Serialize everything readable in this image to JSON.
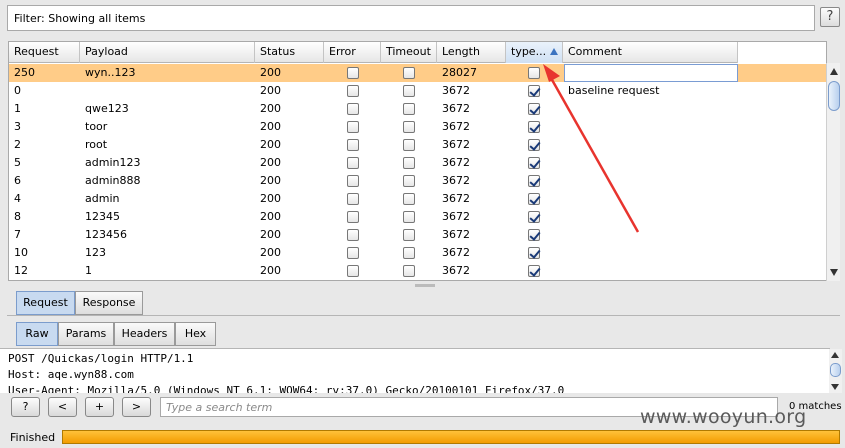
{
  "filter": {
    "text": "Filter: Showing all items",
    "help_label": "?"
  },
  "table": {
    "columns": [
      "Request",
      "Payload",
      "Status",
      "Error",
      "Timeout",
      "Length",
      "type...",
      "Comment"
    ],
    "sorted_column": "type...",
    "rows": [
      {
        "request": "250",
        "payload": "wyn..123",
        "status": "200",
        "error": false,
        "timeout": false,
        "length": "28027",
        "type": false,
        "comment": "",
        "selected": true
      },
      {
        "request": "0",
        "payload": "",
        "status": "200",
        "error": false,
        "timeout": false,
        "length": "3672",
        "type": true,
        "comment": "baseline request",
        "selected": false
      },
      {
        "request": "1",
        "payload": "qwe123",
        "status": "200",
        "error": false,
        "timeout": false,
        "length": "3672",
        "type": true,
        "comment": "",
        "selected": false
      },
      {
        "request": "3",
        "payload": "toor",
        "status": "200",
        "error": false,
        "timeout": false,
        "length": "3672",
        "type": true,
        "comment": "",
        "selected": false
      },
      {
        "request": "2",
        "payload": "root",
        "status": "200",
        "error": false,
        "timeout": false,
        "length": "3672",
        "type": true,
        "comment": "",
        "selected": false
      },
      {
        "request": "5",
        "payload": "admin123",
        "status": "200",
        "error": false,
        "timeout": false,
        "length": "3672",
        "type": true,
        "comment": "",
        "selected": false
      },
      {
        "request": "6",
        "payload": "admin888",
        "status": "200",
        "error": false,
        "timeout": false,
        "length": "3672",
        "type": true,
        "comment": "",
        "selected": false
      },
      {
        "request": "4",
        "payload": "admin",
        "status": "200",
        "error": false,
        "timeout": false,
        "length": "3672",
        "type": true,
        "comment": "",
        "selected": false
      },
      {
        "request": "8",
        "payload": "12345",
        "status": "200",
        "error": false,
        "timeout": false,
        "length": "3672",
        "type": true,
        "comment": "",
        "selected": false
      },
      {
        "request": "7",
        "payload": "123456",
        "status": "200",
        "error": false,
        "timeout": false,
        "length": "3672",
        "type": true,
        "comment": "",
        "selected": false
      },
      {
        "request": "10",
        "payload": "123",
        "status": "200",
        "error": false,
        "timeout": false,
        "length": "3672",
        "type": true,
        "comment": "",
        "selected": false
      },
      {
        "request": "12",
        "payload": "1",
        "status": "200",
        "error": false,
        "timeout": false,
        "length": "3672",
        "type": true,
        "comment": "",
        "selected": false
      }
    ]
  },
  "tabs_top": [
    "Request",
    "Response"
  ],
  "tabs_top_active": "Request",
  "tabs_sub": [
    "Raw",
    "Params",
    "Headers",
    "Hex"
  ],
  "tabs_sub_active": "Raw",
  "editor_lines": [
    "POST /Quickas/login HTTP/1.1",
    "Host: aqe.wyn88.com",
    "User-Agent: Mozilla/5.0 (Windows NT 6.1; WOW64; rv:37.0) Gecko/20100101 Firefox/37.0"
  ],
  "search": {
    "help_label": "?",
    "prev_label": "<",
    "add_label": "+",
    "next_label": ">",
    "placeholder": "Type a search term",
    "matches": "0 matches"
  },
  "status": {
    "label": "Finished",
    "progress": 1.0
  },
  "watermark": "www.wooyun.org",
  "colors": {
    "selected_row": "#ffcc88",
    "progress": "#f39c00",
    "annotation_arrow": "#e8342e"
  }
}
